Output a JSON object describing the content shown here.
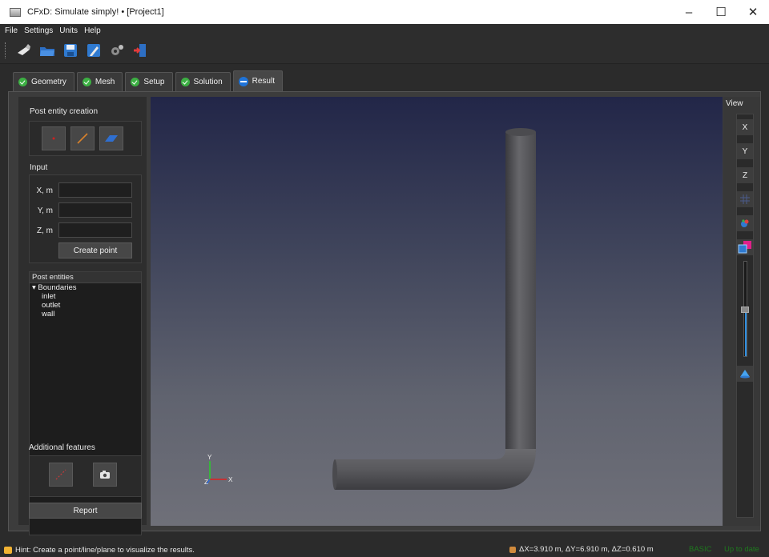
{
  "window": {
    "title": "CFxD: Simulate simply! • [Project1]"
  },
  "menu": [
    "File",
    "Settings",
    "Units",
    "Help"
  ],
  "tabs": [
    {
      "label": "Geometry",
      "status": "ok"
    },
    {
      "label": "Mesh",
      "status": "ok"
    },
    {
      "label": "Setup",
      "status": "ok"
    },
    {
      "label": "Solution",
      "status": "ok"
    },
    {
      "label": "Result",
      "status": "active"
    }
  ],
  "left_panel": {
    "post_entity_creation": "Post entity creation",
    "input": "Input",
    "fields": [
      {
        "label": "X, m",
        "value": ""
      },
      {
        "label": "Y, m",
        "value": ""
      },
      {
        "label": "Z, m",
        "value": ""
      }
    ],
    "create_point": "Create point",
    "post_entities_header": "Post entities",
    "tree": {
      "root": "Boundaries",
      "children": [
        "inlet",
        "outlet",
        "wall"
      ]
    },
    "additional_features": "Additional features",
    "report": "Report"
  },
  "view_panel": {
    "label": "View",
    "axes": [
      "X",
      "Y",
      "Z"
    ]
  },
  "axis_triad": {
    "y": "Y",
    "z": "Z",
    "x": "X"
  },
  "status": {
    "hint": "Hint: Create a point/line/plane to visualize the results.",
    "dimensions": "ΔX=3.910 m, ΔY=6.910 m, ΔZ=0.610 m",
    "mode": "BASIC",
    "state": "Up to date"
  },
  "colors": {
    "ok": "#3cb043",
    "accent": "#2f8fe0",
    "status_green": "#1e7a1e"
  }
}
